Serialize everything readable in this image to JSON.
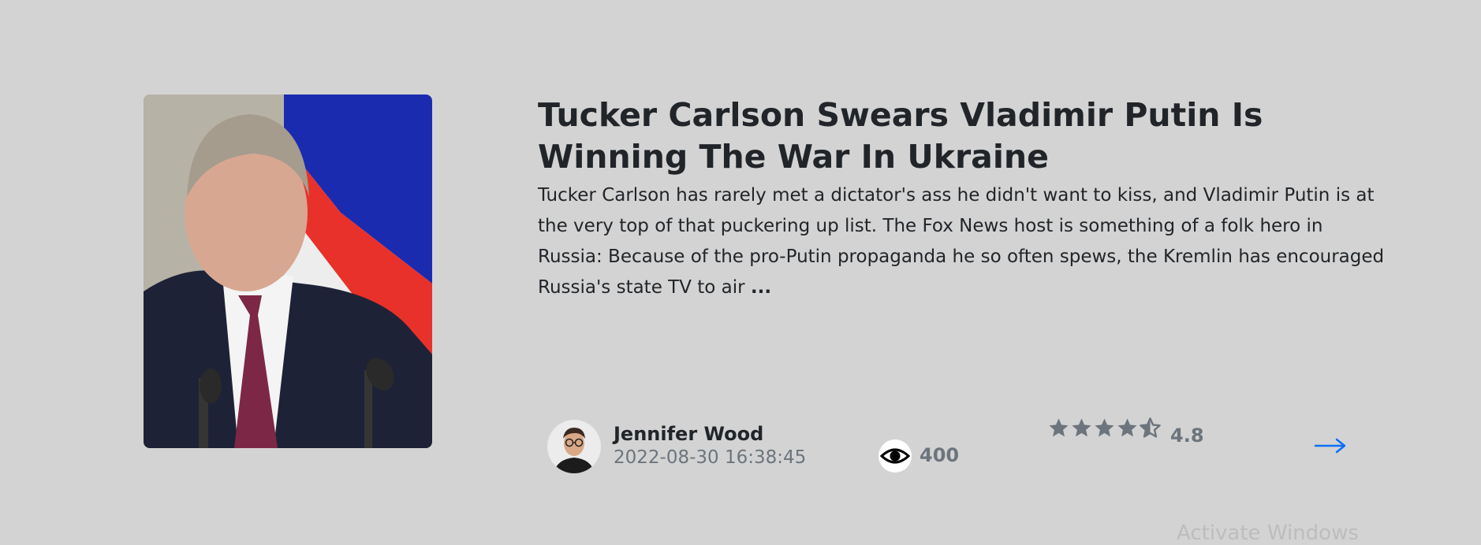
{
  "article": {
    "title": "Tucker Carlson Swears Vladimir Putin Is Winning The War In Ukraine",
    "excerpt": "Tucker Carlson has rarely met a dictator's ass he didn't want to kiss, and Vladimir Putin is at the very top of that puckering up list. The Fox News host is something of a folk hero in Russia: Because of the pro-Putin propaganda he so often spews, the Kremlin has encouraged Russia's state TV to air ",
    "ellipsis": "...",
    "thumbnail_icon": "article-photo"
  },
  "author": {
    "name": "Jennifer Wood",
    "date": "2022-08-30 16:38:45",
    "avatar_icon": "author-avatar"
  },
  "stats": {
    "views": "400",
    "views_icon": "eye-icon",
    "rating": "4.8",
    "rating_value": 4.5,
    "rating_max": 5,
    "star_icon": "star-icon"
  },
  "actions": {
    "read_more_icon": "arrow-right-icon"
  },
  "colors": {
    "background": "#d3d3d3",
    "title": "#212529",
    "muted": "#6c757d",
    "accent": "#0d6efd"
  },
  "watermark": {
    "text": "Activate Windows"
  }
}
